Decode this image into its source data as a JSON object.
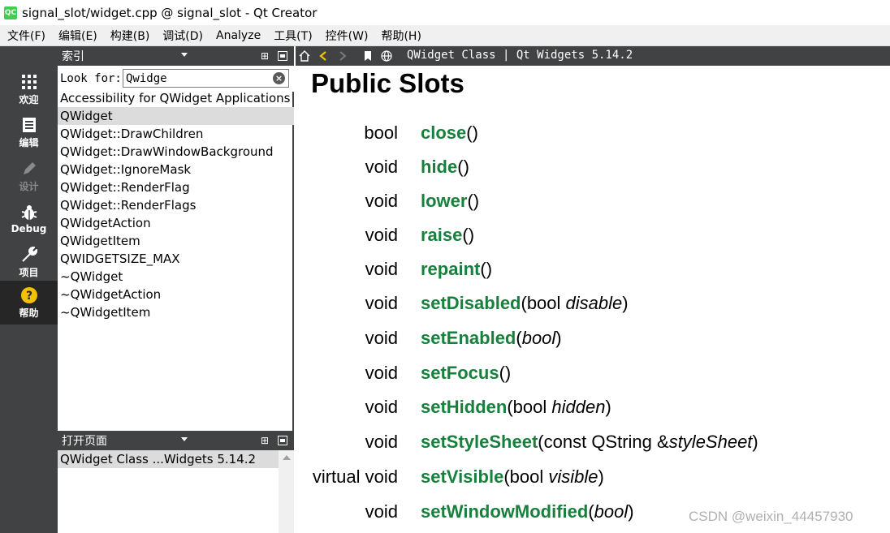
{
  "window": {
    "app_icon_text": "QC",
    "title": "signal_slot/widget.cpp @ signal_slot - Qt Creator"
  },
  "menubar": {
    "items": [
      "文件(F)",
      "编辑(E)",
      "构建(B)",
      "调试(D)",
      "Analyze",
      "工具(T)",
      "控件(W)",
      "帮助(H)"
    ]
  },
  "modebar": {
    "items": [
      {
        "label": "欢迎",
        "icon": "grid-icon",
        "state": "normal"
      },
      {
        "label": "编辑",
        "icon": "document-icon",
        "state": "normal"
      },
      {
        "label": "设计",
        "icon": "pencil-icon",
        "state": "disabled"
      },
      {
        "label": "Debug",
        "icon": "bug-icon",
        "state": "normal"
      },
      {
        "label": "项目",
        "icon": "wrench-icon",
        "state": "normal"
      },
      {
        "label": "帮助",
        "icon": "help-icon",
        "state": "active"
      }
    ]
  },
  "index_panel": {
    "title": "索引",
    "look_for_label": "Look for:",
    "search_value": "Qwidge",
    "items": [
      "Accessibility for QWidget Applications",
      "QWidget",
      "QWidget::DrawChildren",
      "QWidget::DrawWindowBackground",
      "QWidget::IgnoreMask",
      "QWidget::RenderFlag",
      "QWidget::RenderFlags",
      "QWidgetAction",
      "QWidgetItem",
      "QWIDGETSIZE_MAX",
      "~QWidget",
      "~QWidgetAction",
      "~QWidgetItem"
    ],
    "selected_index": 1
  },
  "open_pages_panel": {
    "title": "打开页面",
    "items": [
      "QWidget Class ...Widgets 5.14.2"
    ]
  },
  "help_toolbar": {
    "document_title": "QWidget Class | Qt Widgets 5.14.2"
  },
  "content": {
    "section_title": "Public Slots",
    "slots": [
      {
        "ret": "bool",
        "name": "close",
        "before": "(",
        "param": "",
        "after": ")"
      },
      {
        "ret": "void",
        "name": "hide",
        "before": "(",
        "param": "",
        "after": ")"
      },
      {
        "ret": "void",
        "name": "lower",
        "before": "(",
        "param": "",
        "after": ")"
      },
      {
        "ret": "void",
        "name": "raise",
        "before": "(",
        "param": "",
        "after": ")"
      },
      {
        "ret": "void",
        "name": "repaint",
        "before": "(",
        "param": "",
        "after": ")"
      },
      {
        "ret": "void",
        "name": "setDisabled",
        "before": "(bool ",
        "param": "disable",
        "after": ")"
      },
      {
        "ret": "void",
        "name": "setEnabled",
        "before": "(",
        "param": "bool",
        "after": ")"
      },
      {
        "ret": "void",
        "name": "setFocus",
        "before": "(",
        "param": "",
        "after": ")"
      },
      {
        "ret": "void",
        "name": "setHidden",
        "before": "(bool ",
        "param": "hidden",
        "after": ")"
      },
      {
        "ret": "void",
        "name": "setStyleSheet",
        "before": "(const QString &",
        "param": "styleSheet",
        "after": ")"
      },
      {
        "ret": "virtual void",
        "name": "setVisible",
        "before": "(bool ",
        "param": "visible",
        "after": ")"
      },
      {
        "ret": "void",
        "name": "setWindowModified",
        "before": "(",
        "param": "bool",
        "after": ")"
      }
    ]
  },
  "watermark": "CSDN @weixin_44457930",
  "colors": {
    "sidebar_bg": "#404244",
    "active_mode_bg": "#262626",
    "slot_link": "#17803d",
    "selection": "#dcdcdc"
  }
}
